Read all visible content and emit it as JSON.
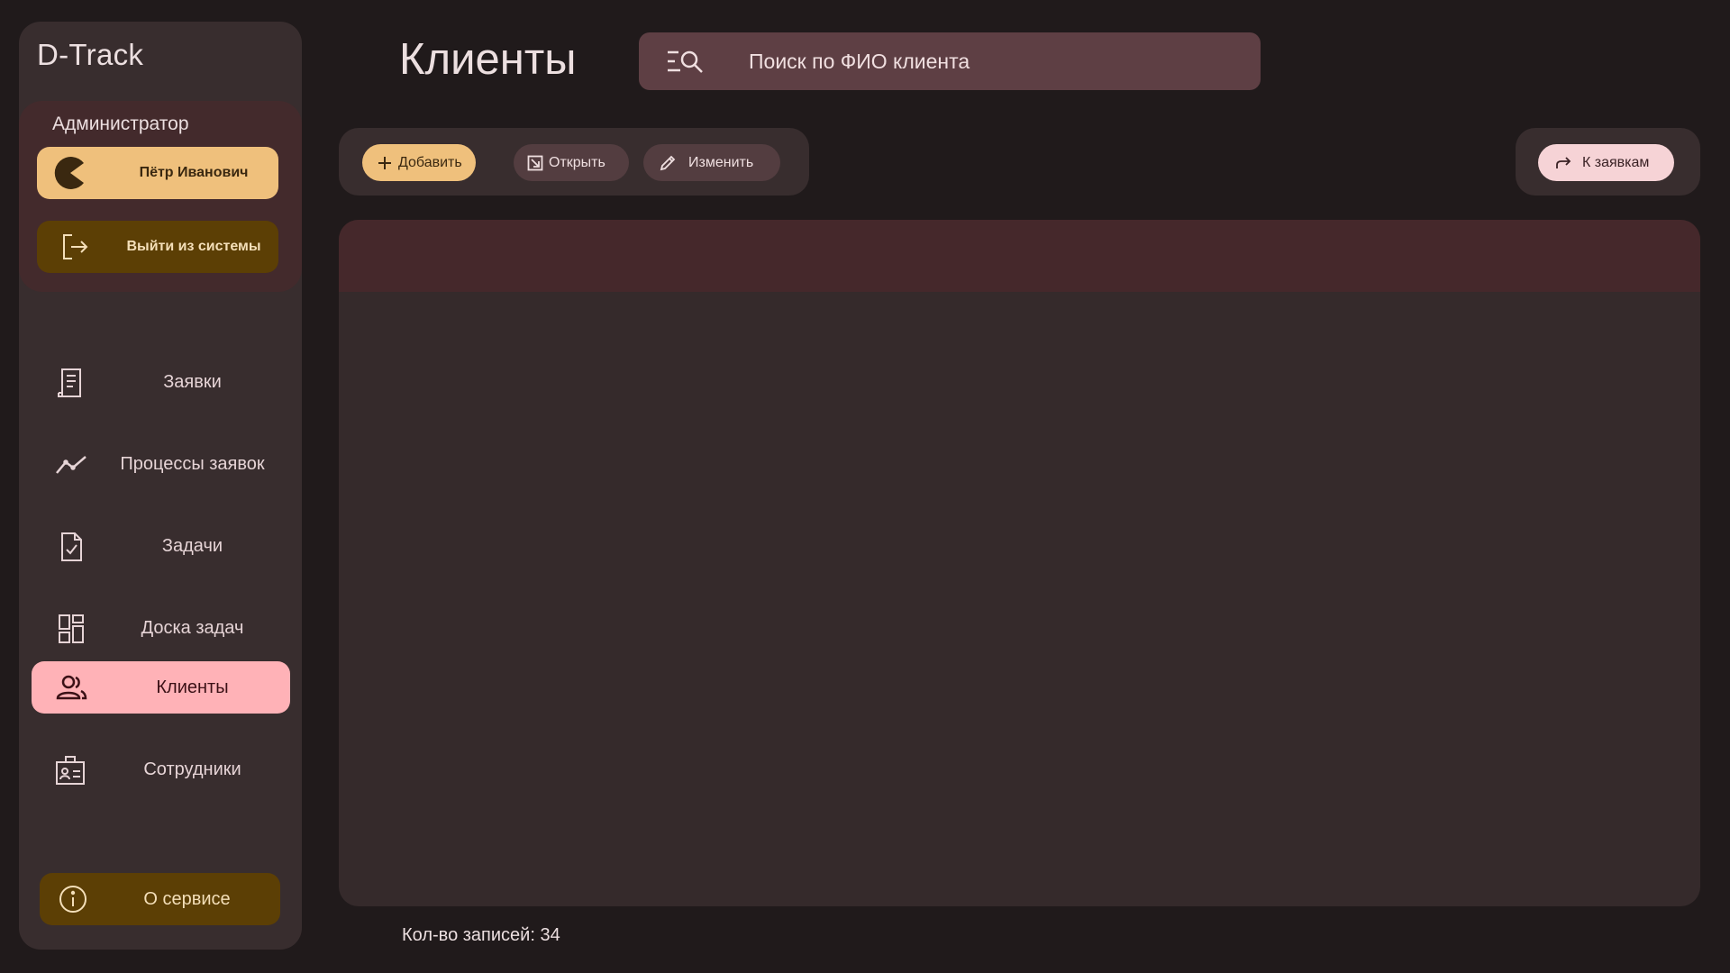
{
  "app": {
    "title": "D-Track"
  },
  "sidebar": {
    "role": "Администратор",
    "user_name": "Пётр Иванович",
    "logout_label": "Выйти из системы",
    "items": [
      {
        "label": "Заявки",
        "icon": "receipt-icon",
        "active": false
      },
      {
        "label": "Процессы заявок",
        "icon": "trend-line-icon",
        "active": false
      },
      {
        "label": "Задачи",
        "icon": "task-check-icon",
        "active": false
      },
      {
        "label": "Доска задач",
        "icon": "dashboard-grid-icon",
        "active": false
      },
      {
        "label": "Клиенты",
        "icon": "people-icon",
        "active": true
      },
      {
        "label": "Сотрудники",
        "icon": "badge-icon",
        "active": false
      }
    ],
    "about_label": "О сервисе"
  },
  "header": {
    "title": "Клиенты",
    "search_placeholder": "Поиск по ФИО клиента"
  },
  "toolbar": {
    "add_label": "Добавить",
    "open_label": "Открыть",
    "edit_label": "Изменить",
    "to_requests_label": "К заявкам"
  },
  "footer": {
    "record_count": "Кол-во записей: 34"
  },
  "colors": {
    "background": "#201a1b",
    "surface": "#382d2e",
    "accent_yellow": "#efc07c",
    "accent_brown": "#5c3f05",
    "active_pink": "#ffb2b7",
    "search_bg": "#5e3f44"
  }
}
